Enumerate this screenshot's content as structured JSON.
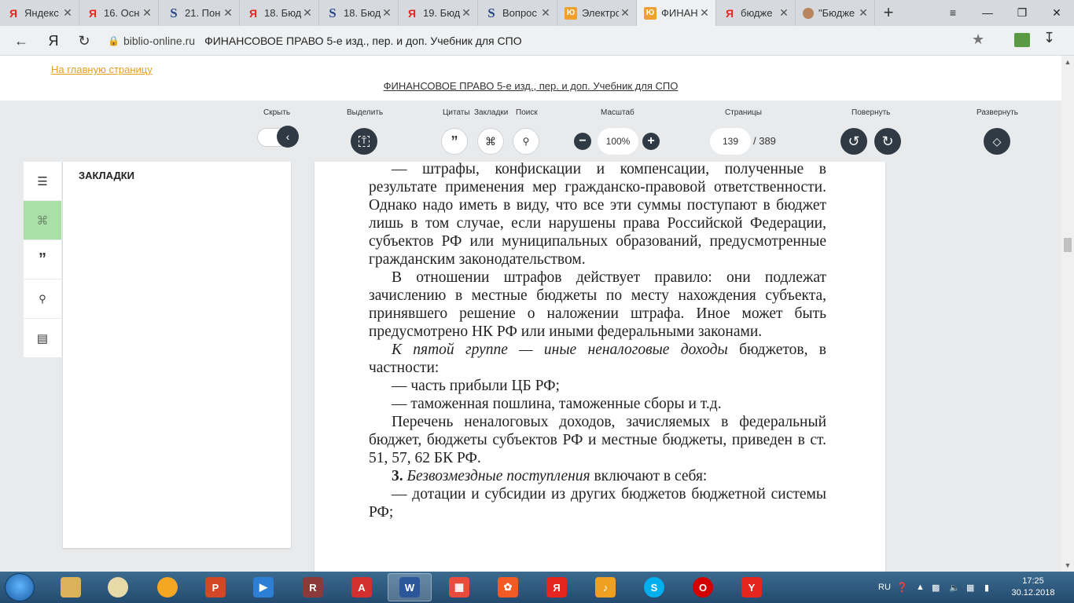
{
  "browser": {
    "tabs": [
      {
        "icon": "yandex-icon",
        "title": "Яндекс"
      },
      {
        "icon": "yandex-icon",
        "title": "16. Осн"
      },
      {
        "icon": "s-icon",
        "title": "21. Пон"
      },
      {
        "icon": "yandex-icon",
        "title": "18. Бюд"
      },
      {
        "icon": "s-icon",
        "title": "18. Бюд"
      },
      {
        "icon": "yandex-icon",
        "title": "19. Бюд"
      },
      {
        "icon": "s-icon",
        "title": "Вопрос"
      },
      {
        "icon": "yurait-icon",
        "title": "Электро"
      },
      {
        "icon": "yurait-icon",
        "title": "ФИНАН",
        "active": true
      },
      {
        "icon": "yandex-icon",
        "title": "бюдже"
      },
      {
        "icon": "face-icon",
        "title": "\"Бюдже"
      }
    ],
    "new_tab": "+",
    "win_controls": {
      "menu": "≡",
      "minimize": "—",
      "maximize": "❐",
      "close": "✕"
    },
    "nav": {
      "back": "←",
      "yandex": "Я",
      "reload": "↻"
    },
    "address": {
      "domain": "biblio-online.ru",
      "title": "ФИНАНСОВОЕ ПРАВО 5-е изд., пер. и доп. Учебник для СПО"
    }
  },
  "page": {
    "home_link": "На главную страницу",
    "book_title": "ФИНАНСОВОЕ ПРАВО 5-е изд., пер. и доп. Учебник для СПО"
  },
  "toolbar": {
    "hide_label": "Скрыть",
    "select_label": "Выделить",
    "quotes_label": "Цитаты",
    "bookmarks_label": "Закладки",
    "search_label": "Поиск",
    "zoom_label": "Масштаб",
    "zoom_value": "100%",
    "zoom_minus": "−",
    "zoom_plus": "+",
    "pages_label": "Страницы",
    "page_current": "139",
    "page_total": "/ 389",
    "rotate_label": "Повернуть",
    "expand_label": "Развернуть"
  },
  "sidebar": {
    "items": [
      "toc-icon",
      "bookmark-icon",
      "quote-icon",
      "search-icon",
      "book-icon"
    ],
    "active": "bookmark-icon",
    "panel_title": "ЗАКЛАДКИ"
  },
  "document": {
    "paragraphs": [
      {
        "cls": "ind",
        "text": "— штрафы, конфискации и компенсации, полученные в результате применения мер гражданско-правовой ответственности. Однако надо иметь в виду, что все эти суммы поступают в бюджет лишь в том случае, если нарушены права Российской Федерации, субъектов РФ или муниципальных образований, предусмотренные гражданским законодательством."
      },
      {
        "cls": "ind",
        "text": "В отношении штрафов действует правило: они подлежат зачислению в местные бюджеты по месту нахождения субъекта, принявшего решение о наложении штрафа. Иное может быть предусмотрено НК РФ или иными федеральными законами."
      },
      {
        "cls": "ind",
        "italic": "К пятой группе — иные неналоговые доходы",
        "text": " бюджетов, в частности:"
      },
      {
        "cls": "ind",
        "text": "— часть прибыли ЦБ РФ;"
      },
      {
        "cls": "ind",
        "text": "— таможенная пошлина, таможенные сборы и т.д."
      },
      {
        "cls": "ind",
        "text": "Перечень неналоговых доходов, зачисляемых в федеральный бюджет, бюджеты субъектов РФ и местные бюджеты, приведен в ст. 51, 57, 62 БК РФ."
      },
      {
        "cls": "ind",
        "bold": "3.",
        "italic": " Безвозмездные поступления",
        "text": " включают в себя:"
      },
      {
        "cls": "ind",
        "text": "— дотации и субсидии из других бюджетов бюджетной системы РФ;"
      }
    ]
  },
  "taskbar": {
    "apps": [
      "explorer-icon",
      "app-icon",
      "orange-app-icon",
      "powerpoint-icon",
      "media-icon",
      "winrar-icon",
      "pdf-icon",
      "word-icon",
      "grid-app-icon",
      "reel-icon",
      "yandex-icon",
      "audio-icon",
      "skype-icon",
      "opera-icon",
      "yandex-browser-icon"
    ],
    "lang": "RU",
    "time": "17:25",
    "date": "30.12.2018"
  }
}
